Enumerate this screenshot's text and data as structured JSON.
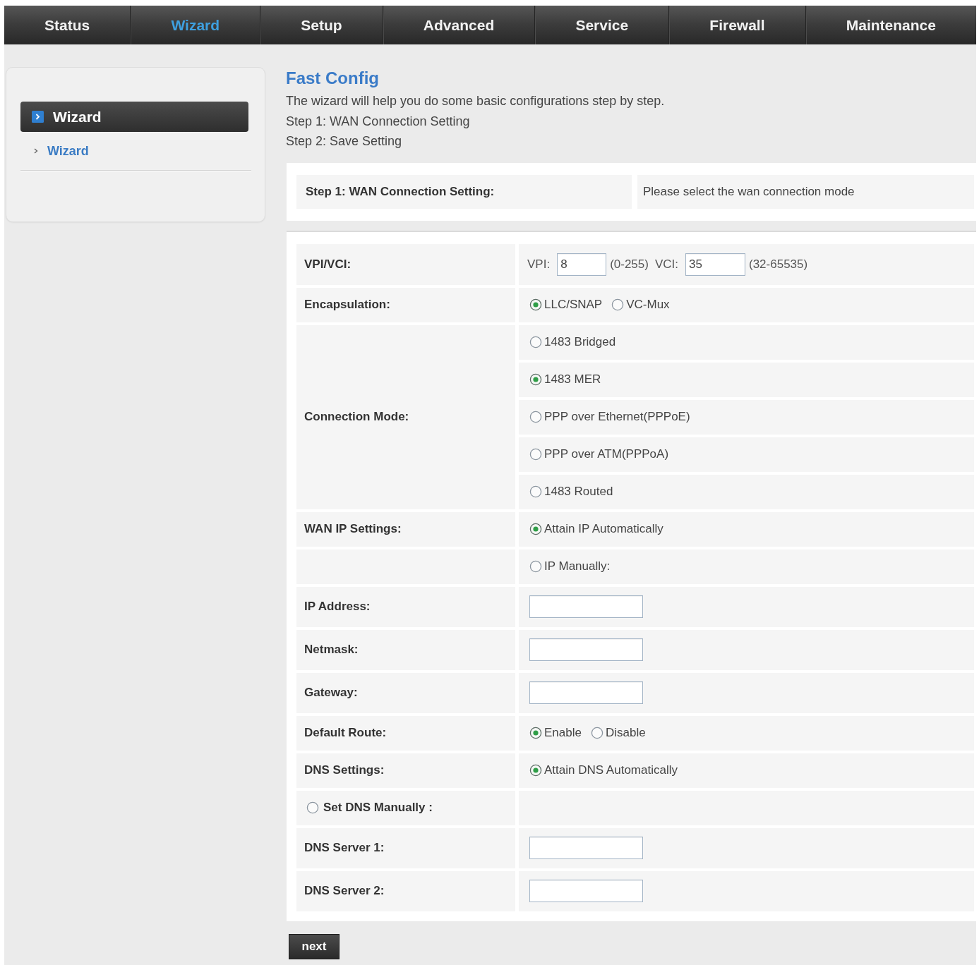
{
  "nav_tabs": [
    {
      "label": "Status",
      "selected": false
    },
    {
      "label": "Wizard",
      "selected": true
    },
    {
      "label": "Setup",
      "selected": false
    },
    {
      "label": "Advanced",
      "selected": false
    },
    {
      "label": "Service",
      "selected": false
    },
    {
      "label": "Firewall",
      "selected": false
    },
    {
      "label": "Maintenance",
      "selected": false
    }
  ],
  "sidebar": {
    "header": "Wizard",
    "items": [
      {
        "label": "Wizard"
      }
    ]
  },
  "content": {
    "title": "Fast Config",
    "intro": [
      "The wizard will help you do some basic configurations step by step.",
      "Step 1: WAN Connection Setting",
      "Step 2: Save Setting"
    ]
  },
  "step_header": {
    "label": "Step 1: WAN Connection Setting:",
    "hint": "Please select the wan connection mode"
  },
  "form_rows": [
    {
      "kind": "vpi_vci",
      "label": "VPI/VCI:",
      "inputs": [
        {
          "prefix": "VPI:",
          "value": "8",
          "range": "(0-255)"
        },
        {
          "prefix": "VCI:",
          "value": "35",
          "range": "(32-65535)"
        }
      ]
    },
    {
      "kind": "radio_inline",
      "label": "Encapsulation:",
      "options": [
        {
          "label": "LLC/SNAP",
          "selected": true
        },
        {
          "label": "VC-Mux",
          "selected": false
        }
      ]
    },
    {
      "kind": "radio_stack",
      "label": "Connection Mode:",
      "options": [
        {
          "label": "1483 Bridged",
          "selected": false
        },
        {
          "label": "1483 MER",
          "selected": true
        },
        {
          "label": "PPP over Ethernet(PPPoE)",
          "selected": false
        },
        {
          "label": "PPP over ATM(PPPoA)",
          "selected": false
        },
        {
          "label": "1483 Routed",
          "selected": false
        }
      ]
    },
    {
      "kind": "radio_list",
      "label": "WAN IP Settings:",
      "options": [
        {
          "label": "Attain IP Automatically",
          "selected": true
        },
        {
          "label": "IP Manually:",
          "selected": false
        }
      ]
    },
    {
      "kind": "text_input",
      "label": "IP Address:"
    },
    {
      "kind": "text_input",
      "label": "Netmask:"
    },
    {
      "kind": "text_input",
      "label": "Gateway:"
    },
    {
      "kind": "radio_inline",
      "label": "Default Route:",
      "options": [
        {
          "label": "Enable",
          "selected": true
        },
        {
          "label": "Disable",
          "selected": false
        }
      ]
    },
    {
      "kind": "radio_inline",
      "label": "DNS Settings:",
      "options": [
        {
          "label": "Attain DNS Automatically",
          "selected": true
        }
      ]
    },
    {
      "kind": "radio_label",
      "option": {
        "label": "Set DNS Manually :",
        "selected": false
      }
    },
    {
      "kind": "text_input",
      "label": "DNS Server 1:"
    },
    {
      "kind": "text_input",
      "label": "DNS Server 2:"
    }
  ],
  "buttons": [
    {
      "label": "next"
    }
  ]
}
